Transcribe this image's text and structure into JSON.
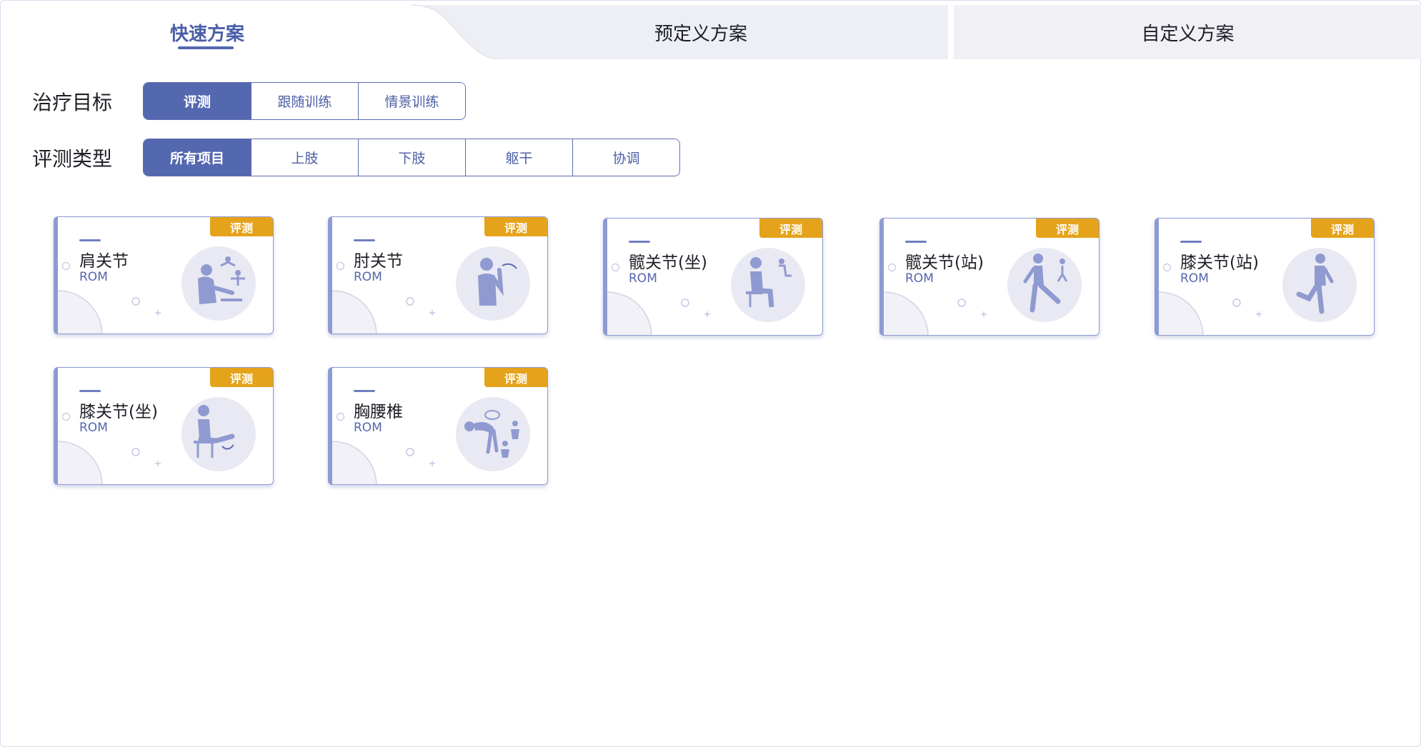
{
  "tabs": [
    {
      "label": "快速方案",
      "active": true
    },
    {
      "label": "预定义方案",
      "active": false
    },
    {
      "label": "自定义方案",
      "active": false
    }
  ],
  "filters": {
    "goal": {
      "label": "治疗目标",
      "options": [
        {
          "label": "评测",
          "active": true
        },
        {
          "label": "跟随训练",
          "active": false
        },
        {
          "label": "情景训练",
          "active": false
        }
      ]
    },
    "type": {
      "label": "评测类型",
      "options": [
        {
          "label": "所有项目",
          "active": true
        },
        {
          "label": "上肢",
          "active": false
        },
        {
          "label": "下肢",
          "active": false
        },
        {
          "label": "躯干",
          "active": false
        },
        {
          "label": "协调",
          "active": false
        }
      ]
    }
  },
  "cards": [
    {
      "title": "肩关节",
      "subtitle": "ROM",
      "badge": "评测",
      "icon": "shoulder-exercise-figure-icon"
    },
    {
      "title": "肘关节",
      "subtitle": "ROM",
      "badge": "评测",
      "icon": "elbow-exercise-figure-icon"
    },
    {
      "title": "髋关节(坐)",
      "subtitle": "ROM",
      "badge": "评测",
      "icon": "hip-seated-figure-icon"
    },
    {
      "title": "髋关节(站)",
      "subtitle": "ROM",
      "badge": "评测",
      "icon": "hip-standing-figure-icon"
    },
    {
      "title": "膝关节(站)",
      "subtitle": "ROM",
      "badge": "评测",
      "icon": "knee-standing-figure-icon"
    },
    {
      "title": "膝关节(坐)",
      "subtitle": "ROM",
      "badge": "评测",
      "icon": "knee-seated-figure-icon"
    },
    {
      "title": "胸腰椎",
      "subtitle": "ROM",
      "badge": "评测",
      "icon": "thoracolumbar-spine-figure-icon"
    }
  ],
  "colors": {
    "primary": "#5468b0",
    "badge": "#e5a31b",
    "card_border": "#8e9bd2",
    "illustration_bg": "#e9e9f3",
    "illustration_fg": "#8f9ad0"
  }
}
